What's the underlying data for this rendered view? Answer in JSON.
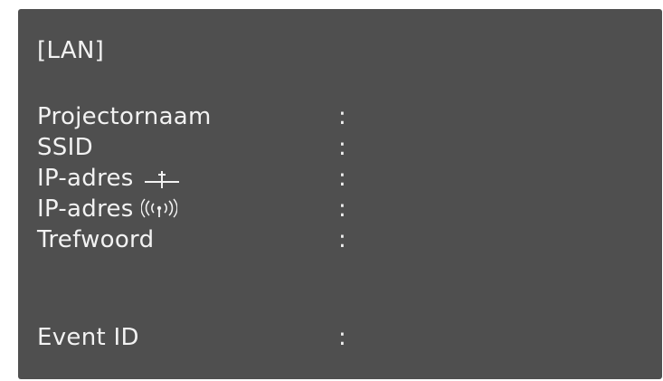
{
  "panel": {
    "title": "[LAN]",
    "rows": [
      {
        "label": "Projectornaam",
        "separator": ":",
        "icon": ""
      },
      {
        "label": "SSID",
        "separator": ":",
        "icon": ""
      },
      {
        "label": "IP-adres",
        "separator": ":",
        "icon": "wired-lan-icon"
      },
      {
        "label": "IP-adres",
        "separator": ":",
        "icon": "wireless-lan-icon"
      },
      {
        "label": "Trefwoord",
        "separator": ":",
        "icon": ""
      },
      {
        "label": "Event ID",
        "separator": ":",
        "icon": ""
      }
    ]
  },
  "colors": {
    "background": "#4f4f4f",
    "text": "#f2f2f2"
  }
}
